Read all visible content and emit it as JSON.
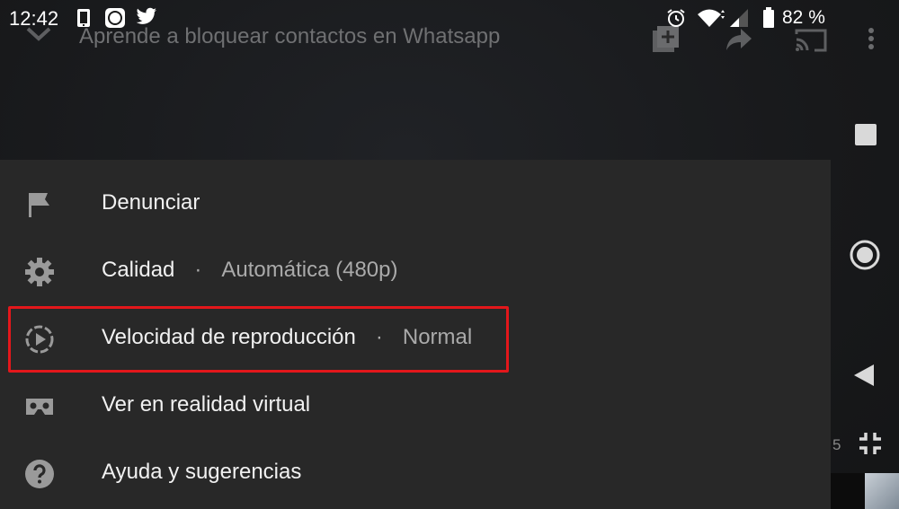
{
  "status_bar": {
    "time": "12:42",
    "battery_percent": "82 %",
    "icons": [
      "phone-icon",
      "app-badge-icon",
      "twitter-icon",
      "alarm-icon",
      "wifi-icon",
      "signal-icon",
      "battery-icon"
    ]
  },
  "player": {
    "title": "Aprende a bloquear contactos en Whatsapp",
    "actions": [
      "collapse-chevron-icon",
      "add-to-playlist-icon",
      "share-icon",
      "cast-icon",
      "more-options-icon"
    ]
  },
  "side_nav": {
    "buttons": [
      "square-recents-icon",
      "circle-home-icon",
      "triangle-back-icon",
      "exit-fullscreen-icon"
    ],
    "partial_label": "5"
  },
  "menu": {
    "items": [
      {
        "icon": "flag-icon",
        "label": "Denunciar",
        "value": ""
      },
      {
        "icon": "gear-icon",
        "label": "Calidad",
        "value": "Automática (480p)"
      },
      {
        "icon": "playback-speed-icon",
        "label": "Velocidad de reproducción",
        "value": "Normal",
        "highlighted": true
      },
      {
        "icon": "vr-headset-icon",
        "label": "Ver en realidad virtual",
        "value": ""
      },
      {
        "icon": "help-icon",
        "label": "Ayuda y sugerencias",
        "value": ""
      }
    ],
    "separator": "·"
  },
  "colors": {
    "menu_background": "#282828",
    "highlight_border": "#e3171b",
    "primary_text": "#f1f1f1",
    "secondary_text": "#aaaaaa"
  }
}
